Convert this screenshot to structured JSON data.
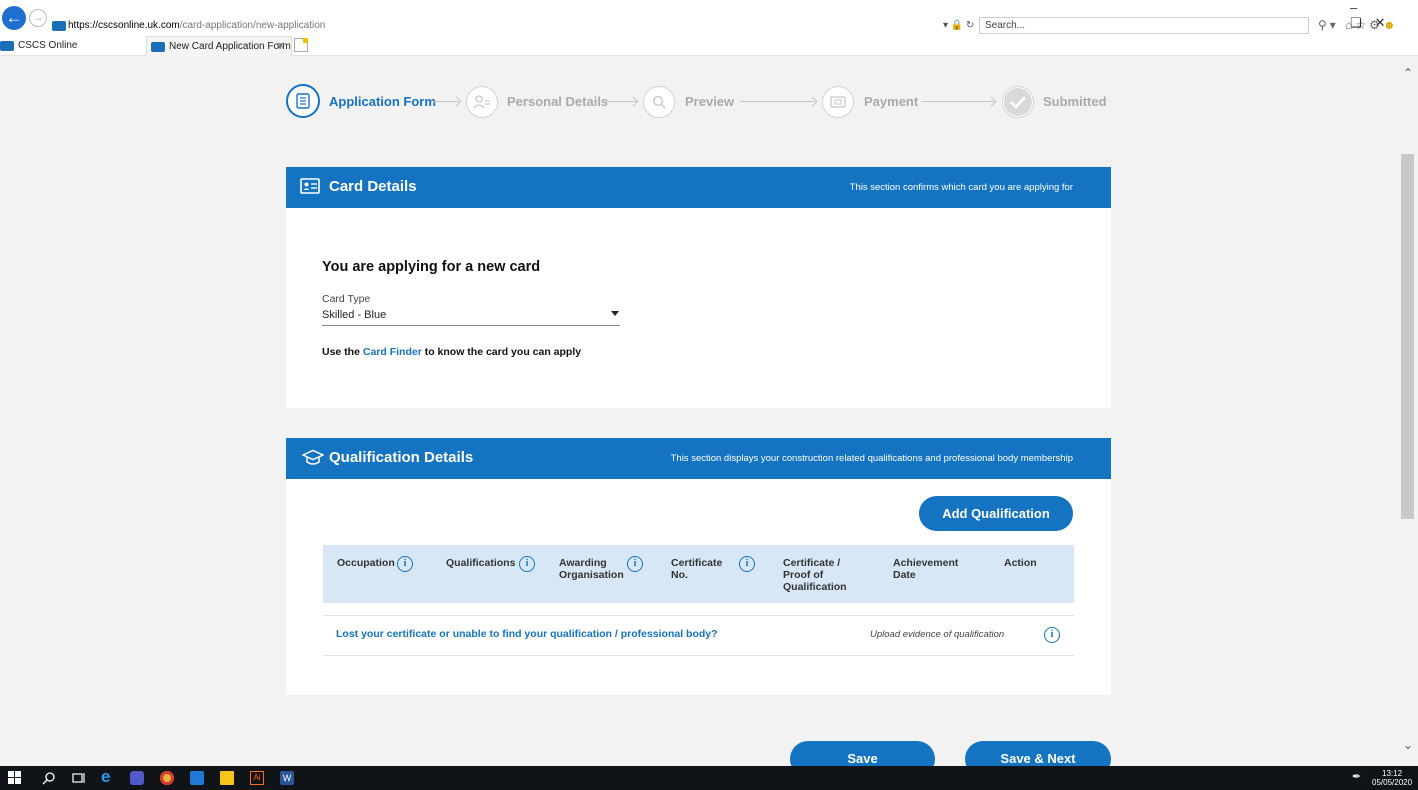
{
  "browser": {
    "url_host": "https://cscsonline.uk.com",
    "url_path": "/card-application/new-application",
    "search_placeholder": "Search...",
    "tabs": [
      {
        "label": "CSCS Online"
      },
      {
        "label": "New Card Application Form"
      }
    ]
  },
  "stepper": {
    "steps": [
      {
        "label": "Application Form",
        "active": true,
        "icon": "document-icon"
      },
      {
        "label": "Personal Details",
        "active": false,
        "icon": "person-icon"
      },
      {
        "label": "Preview",
        "active": false,
        "icon": "magnifier-icon"
      },
      {
        "label": "Payment",
        "active": false,
        "icon": "payment-card-icon"
      },
      {
        "label": "Submitted",
        "active": false,
        "icon": "checkmark-icon"
      }
    ]
  },
  "card_details": {
    "title": "Card Details",
    "subtitle": "This section confirms which card you are applying for",
    "heading": "You are applying for a new card",
    "card_type_label": "Card Type",
    "card_type_value": "Skilled - Blue",
    "finder_prefix": "Use the",
    "finder_link": "Card Finder",
    "finder_suffix": "to know the card you can apply"
  },
  "qualification_details": {
    "title": "Qualification Details",
    "subtitle": "This section displays your construction related qualifications and professional body membership",
    "add_button": "Add Qualification",
    "columns": [
      {
        "label": "Occupation",
        "info": true
      },
      {
        "label": "Qualifications",
        "info": true
      },
      {
        "label": "Awarding Organisation",
        "info": true
      },
      {
        "label": "Certificate No.",
        "info": true
      },
      {
        "label": "Certificate / Proof of Qualification",
        "info": false
      },
      {
        "label": "Achievement Date",
        "info": false
      },
      {
        "label": "Action",
        "info": false
      }
    ],
    "lost_link": "Lost your certificate or unable to find your qualification / professional body?",
    "upload_text": "Upload evidence of qualification"
  },
  "actions": {
    "save": "Save",
    "save_next": "Save & Next"
  },
  "taskbar": {
    "time": "13:12",
    "date": "05/05/2020"
  },
  "colors": {
    "brand_blue": "#1474c2",
    "table_header": "#d8e7f5"
  }
}
